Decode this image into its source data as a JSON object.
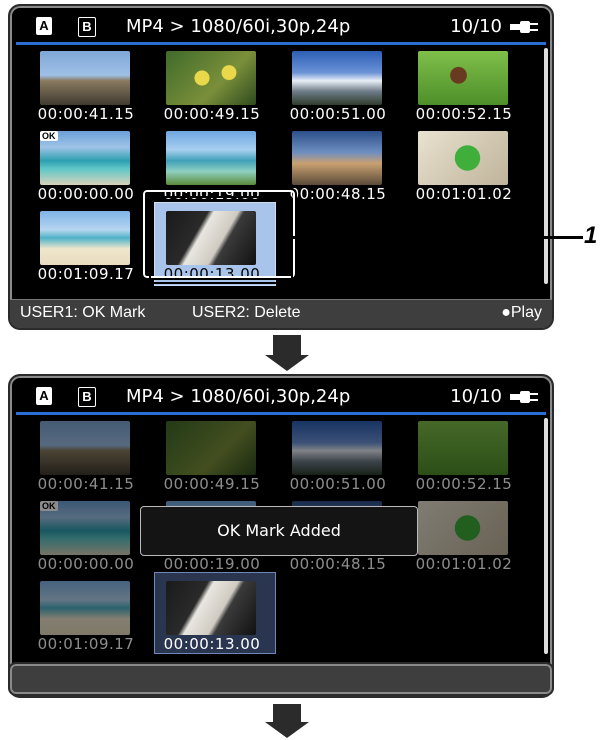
{
  "panel1": {
    "slot_a": "A",
    "slot_b": "B",
    "format": "MP4 > 1080/60i,30p,24p",
    "count": "10/10",
    "ok_badge": "OK",
    "thumbnails": [
      {
        "timecode": "00:00:41.15",
        "scene": "cathedral"
      },
      {
        "timecode": "00:00:49.15",
        "scene": "yellow-flowers"
      },
      {
        "timecode": "00:00:51.00",
        "scene": "mount-fuji"
      },
      {
        "timecode": "00:00:52.15",
        "scene": "dog-on-grass"
      },
      {
        "timecode": "00:00:00.00",
        "scene": "beach-boats",
        "ok_mark": true
      },
      {
        "timecode": "00:00:19.00",
        "scene": "coastline"
      },
      {
        "timecode": "00:00:48.15",
        "scene": "lighthouse"
      },
      {
        "timecode": "00:01:01.02",
        "scene": "parrot"
      },
      {
        "timecode": "00:01:09.17",
        "scene": "beach-toy"
      },
      {
        "timecode": "00:00:13.00",
        "scene": "cat",
        "selected": true
      }
    ],
    "footer": {
      "user1": "USER1: OK Mark",
      "user2": "USER2: Delete",
      "play": "●Play"
    }
  },
  "callout_number": "1",
  "panel2": {
    "slot_a": "A",
    "slot_b": "B",
    "format": "MP4 > 1080/60i,30p,24p",
    "count": "10/10",
    "ok_badge": "OK",
    "thumbnails": [
      {
        "timecode": "00:00:41.15"
      },
      {
        "timecode": "00:00:49.15"
      },
      {
        "timecode": "00:00:51.00"
      },
      {
        "timecode": "00:00:52.15"
      },
      {
        "timecode": "00:00:00.00"
      },
      {
        "timecode": "00:00:19.00"
      },
      {
        "timecode": "00:00:48.15"
      },
      {
        "timecode": "00:01:01.02"
      },
      {
        "timecode": "00:01:09.17"
      },
      {
        "timecode": "00:00:13.00"
      }
    ],
    "popup": "OK Mark Added"
  },
  "colors": {
    "accent_bar": "#2a6fd6",
    "selection": "#a9c4ea",
    "screen_bg": "#000000"
  }
}
